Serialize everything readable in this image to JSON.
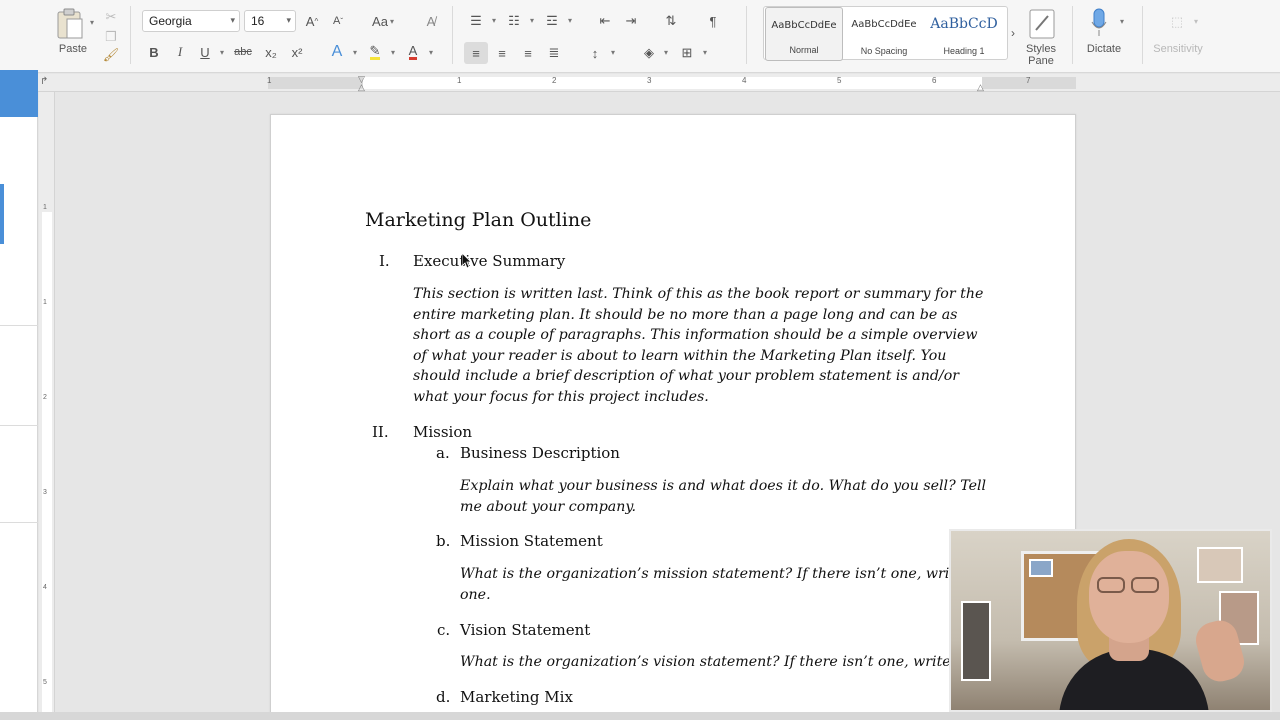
{
  "ribbon": {
    "paste_label": "Paste",
    "font_name": "Georgia",
    "font_size": "16",
    "format_buttons": [
      "B",
      "I",
      "U",
      "abc",
      "x₂",
      "x²"
    ],
    "styles": [
      {
        "preview": "AaBbCcDdEe",
        "name": "Normal"
      },
      {
        "preview": "AaBbCcDdEe",
        "name": "No Spacing"
      },
      {
        "preview": "AaBbCcD",
        "name": "Heading 1"
      }
    ],
    "styles_pane_label": "Styles\nPane",
    "dictate_label": "Dictate",
    "sensitivity_label": "Sensitivity",
    "accent_color": "#4a8fd8",
    "font_color": "#d63b2f",
    "highlight_color": "#f5e33a"
  },
  "ruler": {
    "numbers": [
      "1",
      "1",
      "2",
      "3",
      "4",
      "5",
      "6",
      "7"
    ]
  },
  "vruler": {
    "numbers": [
      "1",
      "1",
      "2",
      "3",
      "4",
      "5"
    ]
  },
  "document": {
    "title": "Marketing Plan Outline",
    "sections": [
      {
        "numeral": "I.",
        "heading": "Executive Summary",
        "lines": [
          "This section is written last.  Think of this as the book report or summary for the",
          "entire marketing plan.  It should be no more than a page long and can be as",
          "short as a couple of paragraphs.  This information should be a simple overview",
          "of what your reader is about to learn within the Marketing Plan itself.  You",
          "should include a brief description of what your problem statement is and/or",
          "what your focus for this project includes."
        ]
      },
      {
        "numeral": "II.",
        "heading": "Mission",
        "subsections": [
          {
            "letter": "a.",
            "heading": "Business Description",
            "lines": [
              "Explain what your business is and what does it do.  What do you sell? Tell",
              "me about your company."
            ]
          },
          {
            "letter": "b.",
            "heading": "Mission Statement",
            "lines": [
              "What is the organization’s mission statement? If there isn’t one, write",
              "one."
            ]
          },
          {
            "letter": "c.",
            "heading": "Vision Statement",
            "lines": [
              "What is the organization’s vision statement? If there isn’t one, write o"
            ]
          },
          {
            "letter": "d.",
            "heading": "Marketing Mix"
          }
        ]
      }
    ]
  }
}
